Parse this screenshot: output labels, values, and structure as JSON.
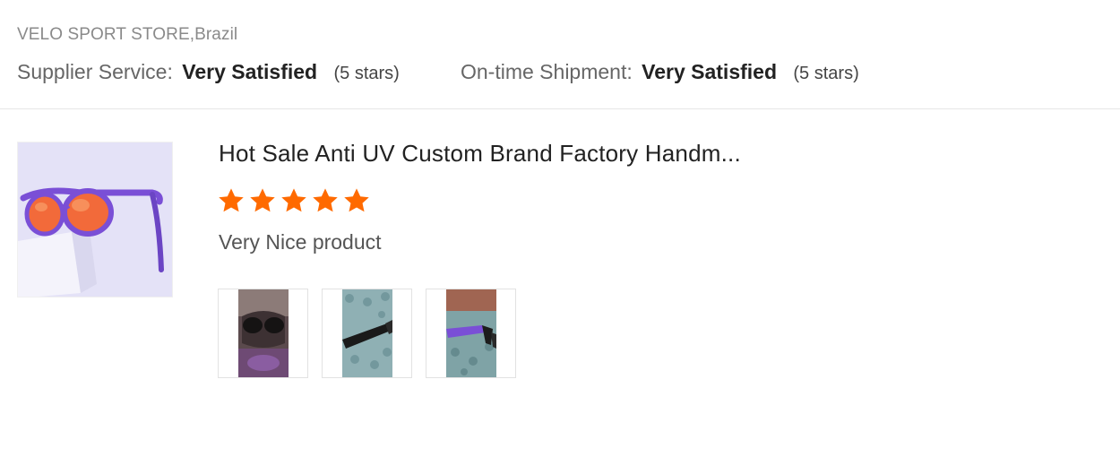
{
  "store": {
    "name_location": "VELO SPORT STORE,Brazil"
  },
  "ratings": {
    "supplier": {
      "label": "Supplier Service:",
      "value": "Very Satisfied",
      "stars": "(5 stars)"
    },
    "shipment": {
      "label": "On-time Shipment:",
      "value": "Very Satisfied",
      "stars": "(5 stars)"
    }
  },
  "review": {
    "product_title": "Hot Sale Anti UV Custom Brand Factory Handm...",
    "rating": 5,
    "rating_max": 5,
    "star_color": "#ff6a00",
    "comment": "Very Nice product",
    "photo_count": 3
  },
  "colors": {
    "accent": "#ff6a00",
    "divider": "#e6e6e6",
    "thumb_background": "#e4e2f7",
    "lens": "#f26a3a",
    "frame": "#7a4fd6"
  }
}
